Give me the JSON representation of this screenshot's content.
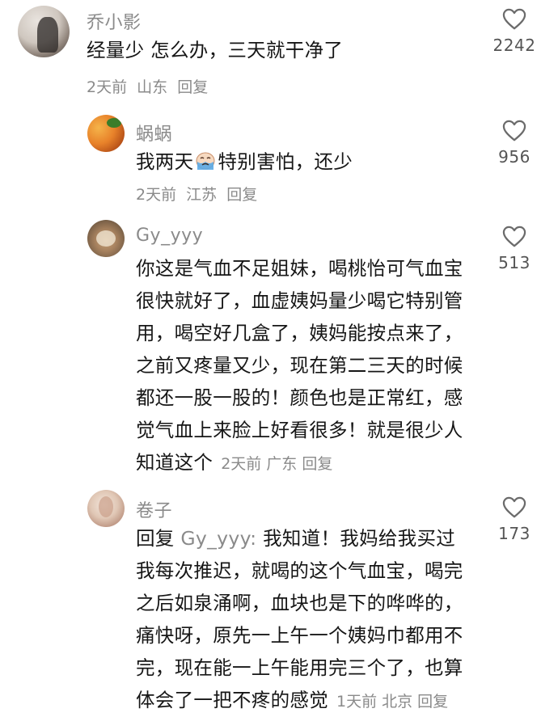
{
  "comments": [
    {
      "username": "乔小影",
      "lines": [
        "经量少 怎么办，三天就干净了"
      ],
      "time": "2天前",
      "location": "山东",
      "reply_label": "回复",
      "likes": "2242",
      "avatar_icon": "user-avatar"
    },
    {
      "username": "蜗蜗",
      "text_before_emoji": "我两天",
      "emoji_icon": "crying-face-icon",
      "text_after_emoji": "特别害怕，还少",
      "time": "2天前",
      "location": "江苏",
      "reply_label": "回复",
      "likes": "956",
      "avatar_icon": "user-avatar"
    },
    {
      "username": "Gy_yyy",
      "lines": [
        "你这是气血不足姐妹，喝桃怡可气血宝",
        "很快就好了，血虚姨妈量少喝它特别管",
        "用，喝空好几盒了，姨妈能按点来了，",
        "之前又疼量又少，现在第二三天的时候",
        "都还一股一股的！颜色也是正常红，感",
        "觉气血上来脸上好看很多！就是很少人",
        "知道这个"
      ],
      "time": "2天前",
      "location": "广东",
      "reply_label": "回复",
      "likes": "513",
      "avatar_icon": "user-avatar"
    },
    {
      "username": "卷子",
      "reply_prefix": "回复",
      "reply_target": "Gy_yyy:",
      "lines": [
        " 我知道！我妈给我买过",
        "我每次推迟，就喝的这个气血宝，喝完",
        "之后如泉涌啊，血块也是下的哗哗的，",
        "痛快呀，原先一上午一个姨妈巾都用不",
        "完，现在能一上午能用完三个了，也算",
        "体会了一把不疼的感觉"
      ],
      "time": "1天前",
      "location": "北京",
      "reply_label": "回复",
      "likes": "173",
      "avatar_icon": "user-avatar"
    }
  ],
  "icons": {
    "like": "heart-outline-icon"
  },
  "colors": {
    "meta_gray": "#8a8a8a",
    "text": "#161616",
    "background": "#ffffff"
  }
}
